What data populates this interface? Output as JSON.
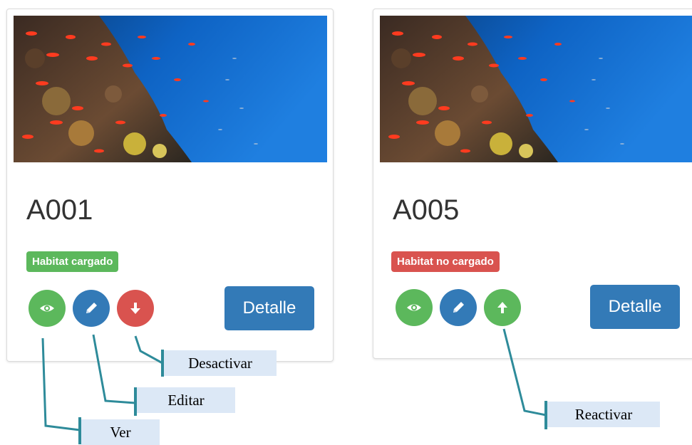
{
  "cards": [
    {
      "title": "A001",
      "badge": "Habitat cargado",
      "badge_color": "#5cb85c",
      "actions": [
        {
          "icon": "eye-icon",
          "color": "#5cb85c"
        },
        {
          "icon": "pencil-icon",
          "color": "#337ab7"
        },
        {
          "icon": "arrow-down-icon",
          "color": "#d9534f"
        }
      ],
      "detail_label": "Detalle"
    },
    {
      "title": "A005",
      "badge": "Habitat no cargado",
      "badge_color": "#d9534f",
      "actions": [
        {
          "icon": "eye-icon",
          "color": "#5cb85c"
        },
        {
          "icon": "pencil-icon",
          "color": "#337ab7"
        },
        {
          "icon": "arrow-up-icon",
          "color": "#5cb85c"
        }
      ],
      "detail_label": "Detalle"
    }
  ],
  "annotations": {
    "desactivar": "Desactivar",
    "editar": "Editar",
    "ver": "Ver",
    "reactivar": "Reactivar"
  },
  "colors": {
    "primary": "#337ab7",
    "success": "#5cb85c",
    "danger": "#d9534f",
    "callout_line": "#2e8b9a",
    "callout_bg": "#dce8f6"
  }
}
